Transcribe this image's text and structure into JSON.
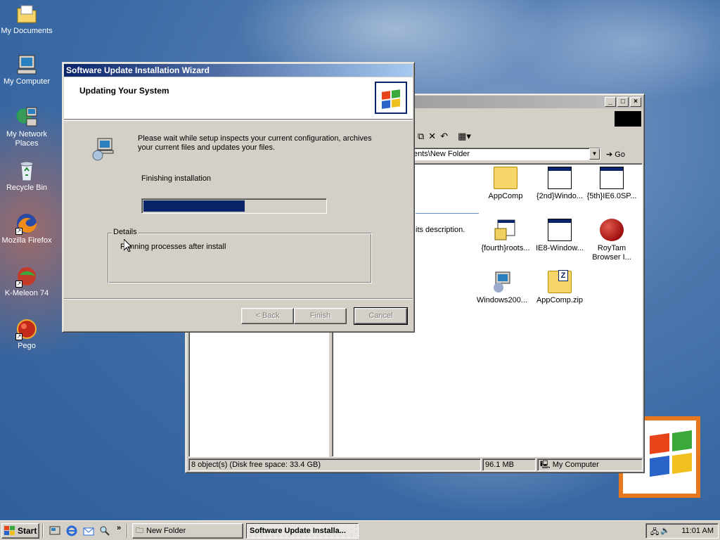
{
  "desktop": {
    "icons": [
      {
        "label": "My Documents"
      },
      {
        "label": "My Computer"
      },
      {
        "label": "My Network Places"
      },
      {
        "label": "Recycle Bin"
      },
      {
        "label": "Mozilla Firefox"
      },
      {
        "label": "K-Meleon 74"
      },
      {
        "label": "Pego"
      }
    ]
  },
  "explorer": {
    "address": "ents\\New Folder",
    "go_label": "Go",
    "description": "its description.",
    "files": [
      {
        "label": "AppComp",
        "icon": "folder-icon"
      },
      {
        "label": "{2nd}Windo...",
        "icon": "app-window-icon"
      },
      {
        "label": "{5th}IE6.0SP...",
        "icon": "app-window-icon"
      },
      {
        "label": "{fourth}roots...",
        "icon": "installer-icon"
      },
      {
        "label": "IE8-Window...",
        "icon": "app-window-icon"
      },
      {
        "label": "RoyTam Browser I...",
        "icon": "red-ball-icon"
      },
      {
        "label": "Windows200...",
        "icon": "setup-icon"
      },
      {
        "label": "AppComp.zip",
        "icon": "zip-folder-icon"
      }
    ],
    "status": {
      "objects": "8 object(s) (Disk free space: 33.4 GB)",
      "size": "96.1 MB",
      "zone": "My Computer"
    }
  },
  "wizard": {
    "title": "Software Update Installation Wizard",
    "heading": "Updating Your System",
    "message": "Please wait while setup inspects your current configuration, archives your current files and updates your files.",
    "status": "Finishing installation",
    "progress": 0.56,
    "details_label": "Details",
    "details_text": "Running processes after install",
    "buttons": {
      "back": "< Back",
      "finish": "Finish",
      "cancel": "Cancel"
    }
  },
  "taskbar": {
    "start": "Start",
    "tasks": [
      {
        "label": "New Folder"
      },
      {
        "label": "Software Update Installa..."
      }
    ],
    "clock": "11:01 AM"
  },
  "colors": {
    "titlebar": "#0a246a",
    "progress": "#0a246a",
    "face": "#d4d0c8"
  }
}
